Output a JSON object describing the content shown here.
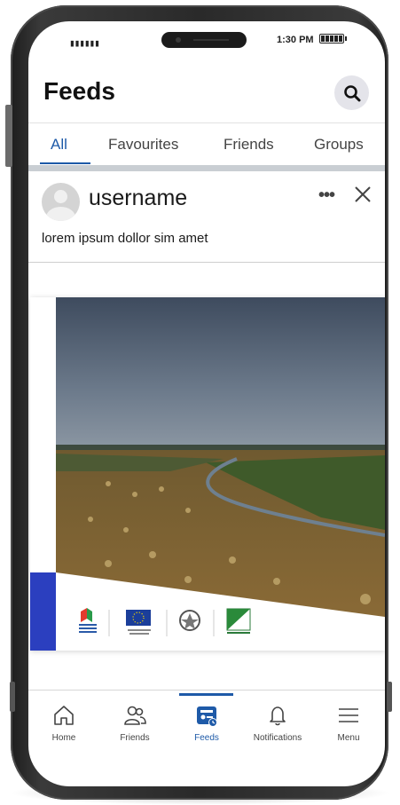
{
  "status_bar": {
    "signal": "▮▮▮▮▮▮",
    "time": "1:30 PM"
  },
  "header": {
    "title": "Feeds",
    "search_icon": "search-icon"
  },
  "tabs": [
    {
      "label": "All",
      "active": true
    },
    {
      "label": "Favourites",
      "active": false
    },
    {
      "label": "Friends",
      "active": false
    },
    {
      "label": "Groups",
      "active": false
    }
  ],
  "post": {
    "username": "username",
    "more_label": "•••",
    "text": "lorem ipsum dollor sim amet"
  },
  "bottom_nav": [
    {
      "label": "Home",
      "icon": "home-icon",
      "active": false
    },
    {
      "label": "Friends",
      "icon": "friends-icon",
      "active": false
    },
    {
      "label": "Feeds",
      "icon": "feeds-icon",
      "active": true
    },
    {
      "label": "Notifications",
      "icon": "bell-icon",
      "active": false
    },
    {
      "label": "Menu",
      "icon": "menu-icon",
      "active": false
    }
  ],
  "colors": {
    "accent": "#1e5aa8",
    "tab_bar": "#c9ced3",
    "flag_blue": "#2b3fbf"
  }
}
